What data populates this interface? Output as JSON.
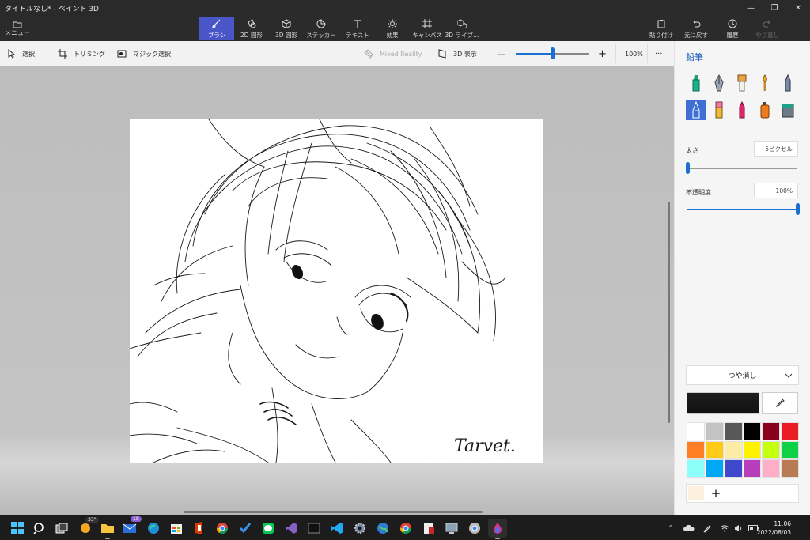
{
  "window": {
    "title": "タイトルなし* - ペイント 3D",
    "minimize": "—",
    "restore": "❐",
    "close": "✕"
  },
  "toolbar": {
    "menu_label": "メニュー",
    "tools": [
      {
        "label": "ブラシ",
        "icon": "brush-icon"
      },
      {
        "label": "2D 図形",
        "icon": "shapes-2d-icon"
      },
      {
        "label": "3D 図形",
        "icon": "cube-icon"
      },
      {
        "label": "ステッカー",
        "icon": "sticker-icon"
      },
      {
        "label": "テキスト",
        "icon": "text-icon"
      },
      {
        "label": "効果",
        "icon": "effects-icon"
      },
      {
        "label": "キャンバス",
        "icon": "canvas-icon"
      },
      {
        "label": "3D ライブ…",
        "icon": "library-3d-icon"
      }
    ],
    "active_tool": "ブラシ",
    "actions": [
      {
        "label": "貼り付け",
        "icon": "paste-icon"
      },
      {
        "label": "元に戻す",
        "icon": "undo-icon"
      },
      {
        "label": "履歴",
        "icon": "history-icon"
      },
      {
        "label": "やり直し",
        "icon": "redo-icon"
      }
    ]
  },
  "subbar": {
    "select": "選択",
    "crop": "トリミング",
    "magic_select": "マジック選択",
    "mixed_reality": "Mixed Reality",
    "view_3d": "3D 表示",
    "zoom_out": "—",
    "zoom_in": "+",
    "zoom_level": "100%",
    "zoom_fraction": 0.5,
    "more": "···"
  },
  "canvas": {
    "signature": "Tarvet."
  },
  "panel": {
    "title": "鉛筆",
    "brushes": [
      "marker-icon",
      "calligraphy-pen-icon",
      "oil-brush-icon",
      "watercolor-icon",
      "pencil-icon",
      "pencil-selected-icon",
      "eraser-icon",
      "crayon-icon",
      "spray-can-icon",
      "fill-bucket-icon"
    ],
    "size_label": "太さ",
    "size_value": "5ピクセル",
    "size_fraction": 0.0,
    "opacity_label": "不透明度",
    "opacity_value": "100%",
    "opacity_fraction": 1.0,
    "finish": "つや消し",
    "current_color": "#1e1e1e",
    "palette": [
      "#ffffff",
      "#c3c3c3",
      "#585858",
      "#000000",
      "#88001b",
      "#ec1c24",
      "#ff7f27",
      "#ffca18",
      "#fdeca6",
      "#fff200",
      "#c4ff0e",
      "#0ed145",
      "#8cfffb",
      "#00a8f3",
      "#3f48cc",
      "#b83dba",
      "#ffaec8",
      "#b97a56"
    ],
    "custom_color": "#fdf0dc",
    "add_label": "+"
  },
  "taskbar": {
    "weather_temp": "33°",
    "mail_badge": "18",
    "time": "11:06",
    "date": "2022/08/03"
  }
}
